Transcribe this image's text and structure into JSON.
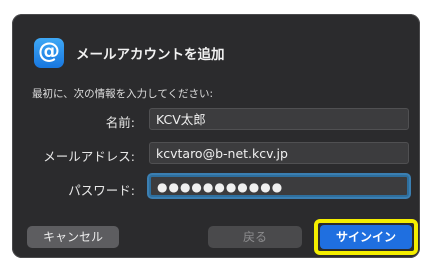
{
  "dialog": {
    "title": "メールアカウントを追加",
    "icon": "at-sign-icon",
    "instructions": "最初に、次の情報を入力してください:"
  },
  "form": {
    "name_label": "名前:",
    "name_value": "KCV太郎",
    "email_label": "メールアドレス:",
    "email_value": "kcvtaro@b-net.kcv.jp",
    "password_label": "パスワード:",
    "password_value": "●●●●●●●●●●●"
  },
  "buttons": {
    "cancel": "キャンセル",
    "back": "戻る",
    "sign_in": "サインイン"
  },
  "colors": {
    "dialog_bg": "#2b2b2d",
    "accent": "#1f6fe0",
    "highlight": "#f4ee00"
  }
}
